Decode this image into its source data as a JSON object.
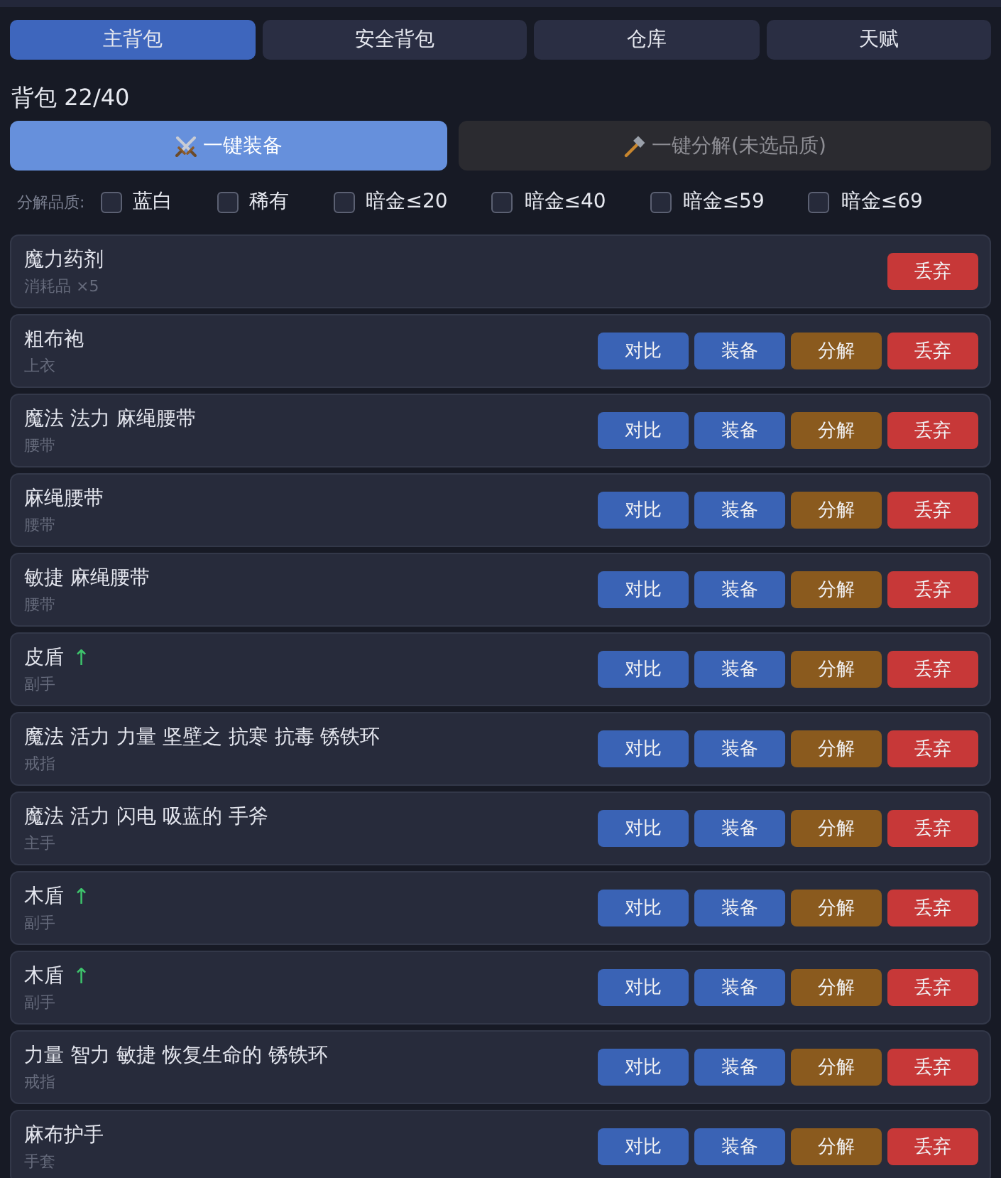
{
  "tabs": [
    {
      "label": "主背包",
      "selected": true
    },
    {
      "label": "安全背包",
      "selected": false
    },
    {
      "label": "仓库",
      "selected": false
    },
    {
      "label": "天赋",
      "selected": false
    }
  ],
  "bag": {
    "title": "背包 22/40"
  },
  "actions": [
    {
      "kind": "equip",
      "label": "一键装备",
      "disabled": false
    },
    {
      "kind": "decompose",
      "label": "一键分解(未选品质)",
      "disabled": true
    }
  ],
  "filter": {
    "label": "分解品质:",
    "options": [
      {
        "label": "蓝白",
        "checked": false
      },
      {
        "label": "稀有",
        "checked": false
      },
      {
        "label": "暗金≤20",
        "checked": false
      },
      {
        "label": "暗金≤40",
        "checked": false
      },
      {
        "label": "暗金≤59",
        "checked": false
      },
      {
        "label": "暗金≤69",
        "checked": false
      }
    ]
  },
  "items": [
    {
      "name": "魔力药剂",
      "slot": "消耗品 ×5",
      "buttons": [
        {
          "kind": "discard",
          "label": "丢弃"
        }
      ]
    },
    {
      "name": "粗布袍",
      "slot": "上衣",
      "buttons": [
        {
          "kind": "compare",
          "label": "对比"
        },
        {
          "kind": "equip",
          "label": "装备"
        },
        {
          "kind": "decompose",
          "label": "分解"
        },
        {
          "kind": "discard",
          "label": "丢弃"
        }
      ]
    },
    {
      "name": "魔法 法力 麻绳腰带",
      "slot": "腰带",
      "buttons": [
        {
          "kind": "compare",
          "label": "对比"
        },
        {
          "kind": "equip",
          "label": "装备"
        },
        {
          "kind": "decompose",
          "label": "分解"
        },
        {
          "kind": "discard",
          "label": "丢弃"
        }
      ]
    },
    {
      "name": "麻绳腰带",
      "slot": "腰带",
      "buttons": [
        {
          "kind": "compare",
          "label": "对比"
        },
        {
          "kind": "equip",
          "label": "装备"
        },
        {
          "kind": "decompose",
          "label": "分解"
        },
        {
          "kind": "discard",
          "label": "丢弃"
        }
      ]
    },
    {
      "name": "敏捷 麻绳腰带",
      "slot": "腰带",
      "buttons": [
        {
          "kind": "compare",
          "label": "对比"
        },
        {
          "kind": "equip",
          "label": "装备"
        },
        {
          "kind": "decompose",
          "label": "分解"
        },
        {
          "kind": "discard",
          "label": "丢弃"
        }
      ]
    },
    {
      "name": "皮盾",
      "indicator": "↑",
      "slot": "副手",
      "buttons": [
        {
          "kind": "compare",
          "label": "对比"
        },
        {
          "kind": "equip",
          "label": "装备"
        },
        {
          "kind": "decompose",
          "label": "分解"
        },
        {
          "kind": "discard",
          "label": "丢弃"
        }
      ]
    },
    {
      "name": "魔法 活力 力量 坚壁之 抗寒 抗毒 锈铁环",
      "slot": "戒指",
      "buttons": [
        {
          "kind": "compare",
          "label": "对比"
        },
        {
          "kind": "equip",
          "label": "装备"
        },
        {
          "kind": "decompose",
          "label": "分解"
        },
        {
          "kind": "discard",
          "label": "丢弃"
        }
      ]
    },
    {
      "name": "魔法 活力 闪电 吸蓝的 手斧",
      "slot": "主手",
      "buttons": [
        {
          "kind": "compare",
          "label": "对比"
        },
        {
          "kind": "equip",
          "label": "装备"
        },
        {
          "kind": "decompose",
          "label": "分解"
        },
        {
          "kind": "discard",
          "label": "丢弃"
        }
      ]
    },
    {
      "name": "木盾",
      "indicator": "↑",
      "slot": "副手",
      "buttons": [
        {
          "kind": "compare",
          "label": "对比"
        },
        {
          "kind": "equip",
          "label": "装备"
        },
        {
          "kind": "decompose",
          "label": "分解"
        },
        {
          "kind": "discard",
          "label": "丢弃"
        }
      ]
    },
    {
      "name": "木盾",
      "indicator": "↑",
      "slot": "副手",
      "buttons": [
        {
          "kind": "compare",
          "label": "对比"
        },
        {
          "kind": "equip",
          "label": "装备"
        },
        {
          "kind": "decompose",
          "label": "分解"
        },
        {
          "kind": "discard",
          "label": "丢弃"
        }
      ]
    },
    {
      "name": "力量 智力 敏捷 恢复生命的 锈铁环",
      "slot": "戒指",
      "buttons": [
        {
          "kind": "compare",
          "label": "对比"
        },
        {
          "kind": "equip",
          "label": "装备"
        },
        {
          "kind": "decompose",
          "label": "分解"
        },
        {
          "kind": "discard",
          "label": "丢弃"
        }
      ]
    },
    {
      "name": "麻布护手",
      "slot": "手套",
      "buttons": [
        {
          "kind": "compare",
          "label": "对比"
        },
        {
          "kind": "equip",
          "label": "装备"
        },
        {
          "kind": "decompose",
          "label": "分解"
        },
        {
          "kind": "discard",
          "label": "丢弃"
        }
      ]
    }
  ]
}
